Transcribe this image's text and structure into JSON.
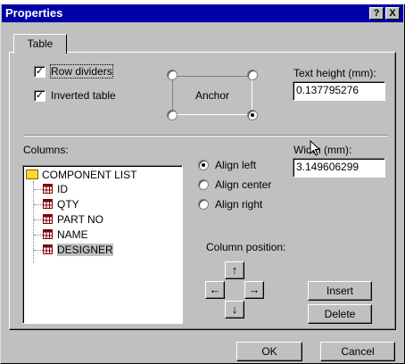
{
  "window": {
    "title": "Properties",
    "help_button": "?",
    "close_button": "X"
  },
  "tab": {
    "label": "Table"
  },
  "options": {
    "row_dividers": {
      "label": "Row dividers",
      "checked": true
    },
    "inverted_table": {
      "label": "Inverted table",
      "checked": true
    }
  },
  "anchor": {
    "label": "Anchor",
    "selected_corner": "bottom-right"
  },
  "text_height": {
    "label": "Text height (mm):",
    "value": "0.137795276"
  },
  "columns": {
    "label": "Columns:",
    "root": "COMPONENT LIST",
    "items": [
      "ID",
      "QTY",
      "PART NO",
      "NAME",
      "DESIGNER"
    ],
    "selected": "DESIGNER"
  },
  "align": {
    "options": [
      "Align left",
      "Align center",
      "Align right"
    ],
    "selected": "Align left"
  },
  "width": {
    "label": "Width (mm):",
    "value": "3.149606299"
  },
  "column_position": {
    "label": "Column position:"
  },
  "buttons": {
    "insert": "Insert",
    "delete": "Delete",
    "ok": "OK",
    "cancel": "Cancel"
  }
}
